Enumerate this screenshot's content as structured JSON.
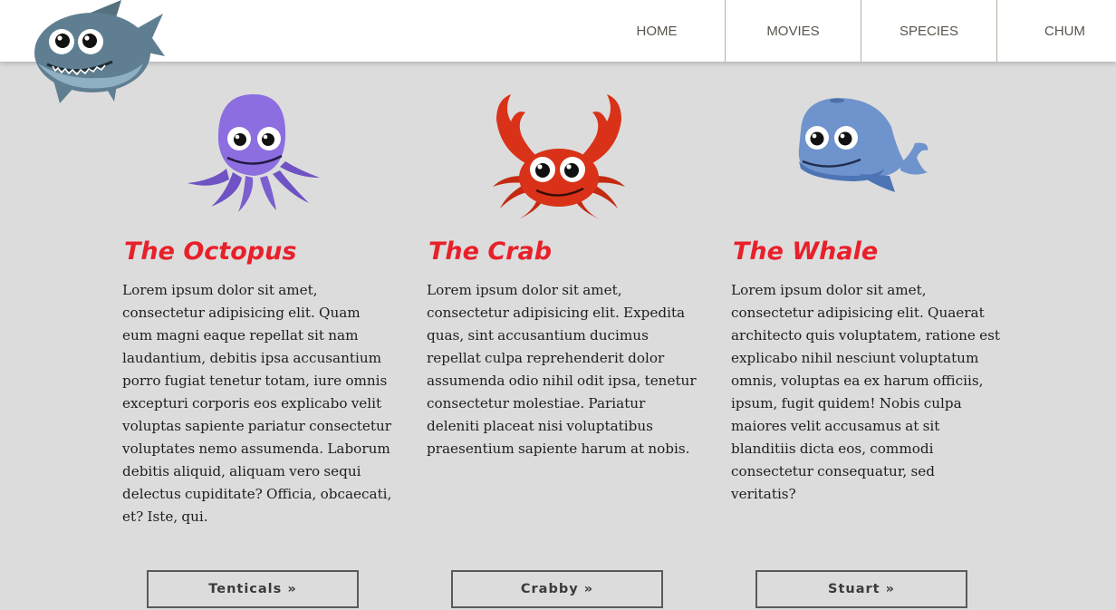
{
  "nav": {
    "items": [
      {
        "label": "HOME"
      },
      {
        "label": "MOVIES"
      },
      {
        "label": "SPECIES"
      },
      {
        "label": "CHUM"
      }
    ]
  },
  "logo": {
    "icon": "shark-icon"
  },
  "columns": [
    {
      "icon": "octopus-icon",
      "title": "The Octopus",
      "body": "Lorem ipsum dolor sit amet, consectetur adipisicing elit. Quam eum magni eaque repellat sit nam laudantium, debitis ipsa accusantium porro fugiat tenetur totam, iure omnis excepturi corporis eos explicabo velit voluptas sapiente pariatur consectetur voluptates nemo assumenda. Laborum debitis aliquid, aliquam vero sequi delectus cupiditate? Officia, obcaecati, et? Iste, qui.",
      "button": "Tenticals »"
    },
    {
      "icon": "crab-icon",
      "title": "The Crab",
      "body": "Lorem ipsum dolor sit amet, consectetur adipisicing elit. Expedita quas, sint accusantium ducimus repellat culpa reprehenderit dolor assumenda odio nihil odit ipsa, tenetur consectetur molestiae. Pariatur deleniti placeat nisi voluptatibus praesentium sapiente harum at nobis.",
      "button": "Crabby »"
    },
    {
      "icon": "whale-icon",
      "title": "The Whale",
      "body": "Lorem ipsum dolor sit amet, consectetur adipisicing elit. Quaerat architecto quis voluptatem, ratione est explicabo nihil nesciunt voluptatum omnis, voluptas ea ex harum officiis, ipsum, fugit quidem! Nobis culpa maiores velit accusamus at sit blanditiis dicta eos, commodi consectetur consequatur, sed veritatis?",
      "button": "Stuart »"
    }
  ],
  "colors": {
    "accent": "#e8202a",
    "header": "#ffffff",
    "background": "#dcdcdc",
    "nav_text": "#5a544c",
    "octopus": "#8c6ee0",
    "crab": "#d93218",
    "whale": "#6f93cc",
    "shark": "#5f7e91"
  }
}
